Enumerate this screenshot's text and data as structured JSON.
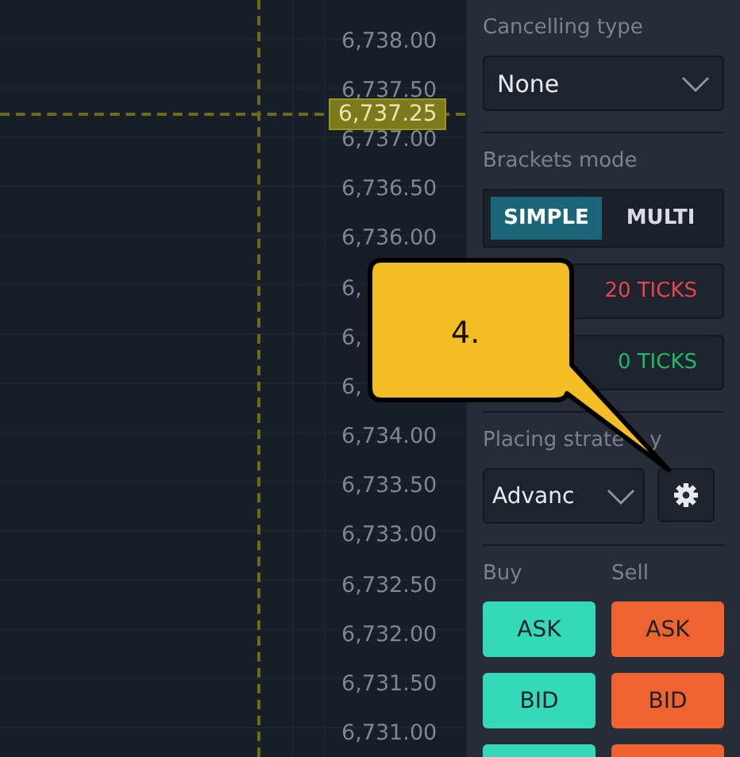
{
  "price_axis": {
    "labels": [
      "6,738.00",
      "6,737.50",
      "6,737.00",
      "6,736.50",
      "6,736.00",
      "6,",
      "6,",
      "6,",
      "6,734.00",
      "6,733.50",
      "6,733.00",
      "6,732.50",
      "6,732.00",
      "6,731.50",
      "6,731.00"
    ],
    "crosshair_price": "6,737.25"
  },
  "panel": {
    "cancelling_type": {
      "label": "Cancelling type",
      "value": "None"
    },
    "brackets_mode": {
      "label": "Brackets mode",
      "options": [
        {
          "label": "SIMPLE",
          "selected": true
        },
        {
          "label": "MULTI",
          "selected": false
        }
      ]
    },
    "brackets": [
      {
        "kind": "stop",
        "label": "20 TICKS"
      },
      {
        "kind": "profit",
        "label": "0 TICKS"
      }
    ],
    "placing_strategy": {
      "label": "Placing strate",
      "label_end": "y",
      "value": "Advanc"
    },
    "buy_label": "Buy",
    "sell_label": "Sell",
    "order_rows": [
      {
        "buy": "ASK",
        "sell": "ASK"
      },
      {
        "buy": "BID",
        "sell": "BID"
      },
      {}
    ]
  },
  "callout": {
    "text": "4."
  }
}
